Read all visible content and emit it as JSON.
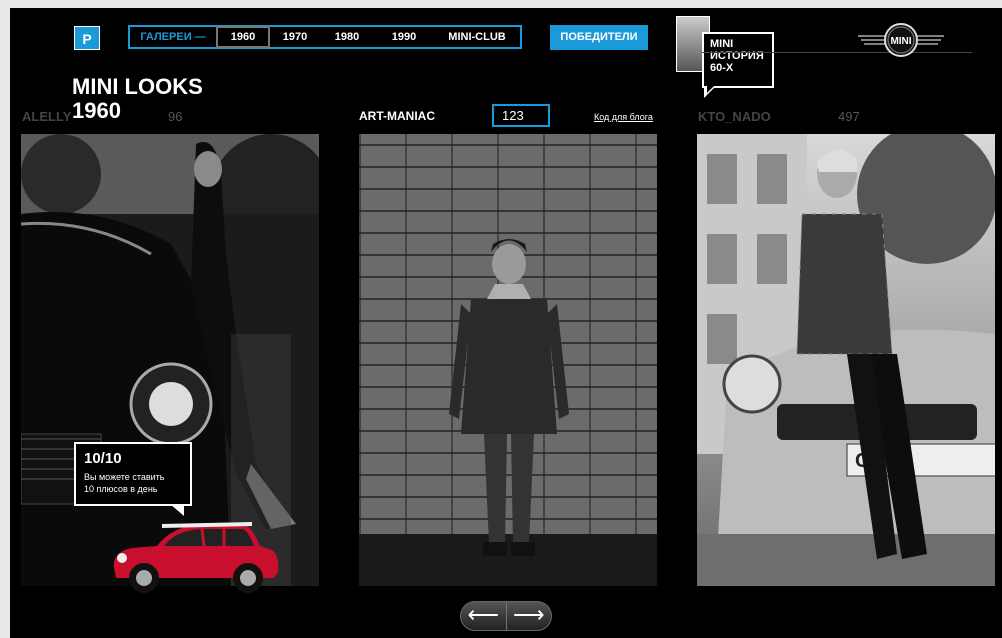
{
  "nav": {
    "logo_letter": "P",
    "gallery": "ГАЛЕРЕИ —",
    "years": [
      "1960",
      "1970",
      "1980",
      "1990"
    ],
    "mini_club": "MINI-CLUB",
    "winners": "ПОБЕДИТЕЛИ"
  },
  "history": {
    "line1": "MINI",
    "line2": "ИСТОРИЯ",
    "line3": "60-Х"
  },
  "brand_logo_text": "MINI",
  "title": "MINI LOOKS",
  "year": "1960",
  "entries": [
    {
      "user": "ALELLY",
      "score": "96"
    },
    {
      "user": "ART-MANIAC",
      "score": "123",
      "blog_code": "Код для блога"
    },
    {
      "user": "KTO_NADO",
      "score": "497"
    }
  ],
  "vote": {
    "count": "10/10",
    "line1": "Вы можете ставить",
    "line2": "10 плюсов в день"
  },
  "arrows": {
    "left": "⟵",
    "right": "⟶"
  },
  "colors": {
    "accent": "#1a9ad9",
    "background": "#000000",
    "car_red": "#c8102e"
  }
}
